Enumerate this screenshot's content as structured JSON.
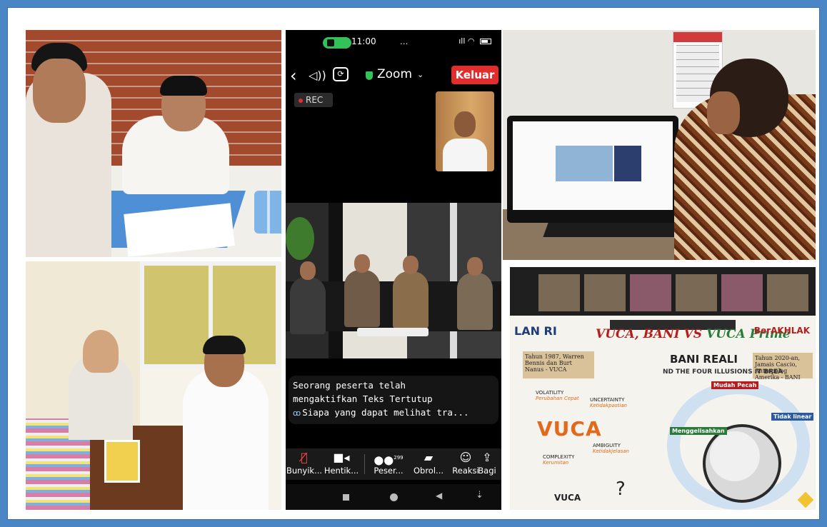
{
  "zoom": {
    "status_time": "11:00",
    "status_dots": "...",
    "app_title": "Zoom",
    "leave_label": "Keluar",
    "rec_label": "REC",
    "caption_line1": "Seorang peserta telah",
    "caption_line2": "mengaktifkan Teks Tertutup",
    "caption_line3": "Siapa yang dapat melihat tra...",
    "controls": [
      {
        "label": "Bunyik..."
      },
      {
        "label": "Hentik..."
      },
      {
        "label": "Peser...",
        "count": "299"
      },
      {
        "label": "Obrol..."
      },
      {
        "label": "Reaksi"
      },
      {
        "label": "Bagi"
      }
    ],
    "colors": {
      "leave": "#e02e2e",
      "shield": "#33c15a",
      "rec_dot": "#e02e2e"
    }
  },
  "slide": {
    "logo_text": "LAN RI",
    "title_vuca": "VUCA, BANI VS ",
    "title_prime": "VUCA Prime",
    "brand_right": "BerAKHLAK",
    "note_left": "Tahun 1987, Warren Bennis dan Burt Nanus - VUCA",
    "note_right": "Tahun 2020-an, Jamais Cascio, Antropolog Amerika - BANI",
    "heading": "BANI REALI",
    "subheading": "ND THE FOUR ILLUSIONS IT BREA",
    "vuca_big": "VUCA",
    "volatility": "VOLATILITY",
    "volatility_id": "Perubahan Cepat",
    "uncertainty": "UNCERTAINTY",
    "uncertainty_id": "Ketidakpastian",
    "complexity": "COMPLEXITY",
    "complexity_id": "Kerumitan",
    "ambiguity": "AMBIGUITY",
    "ambiguity_id": "Ketidakjelasan",
    "mudah_pecah": "Mudah Pecah",
    "menggelisahkan": "Menggelisahkan",
    "tidak_linear": "Tidak linear",
    "vuca_small": "VUCA",
    "question": "?"
  }
}
